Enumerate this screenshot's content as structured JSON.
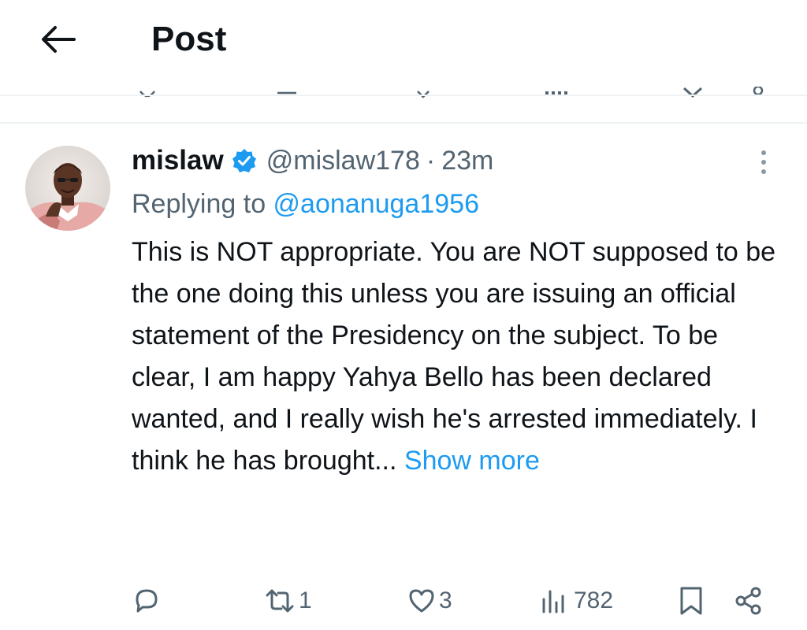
{
  "header": {
    "title": "Post",
    "back_icon": "arrow-left-icon"
  },
  "post": {
    "author_name": "mislaw",
    "verified": true,
    "handle": "@mislaw178",
    "separator": "·",
    "time": "23m",
    "reply_prefix": "Replying to ",
    "reply_to": "@aonanuga1956",
    "body": "This is NOT appropriate. You are NOT supposed to be the one doing this unless you are issuing an official statement of the Presidency on the subject. To be clear, I am happy Yahya Bello has been declared wanted, and I really wish he's arrested immediately.  I think he has brought...",
    "show_more": "Show more"
  },
  "actions": {
    "reply_count": "",
    "repost_count": "1",
    "like_count": "3",
    "views_count": "782"
  },
  "colors": {
    "accent": "#1d9bf0",
    "text": "#0f1419",
    "muted": "#536471",
    "divider": "#eff3f4"
  }
}
